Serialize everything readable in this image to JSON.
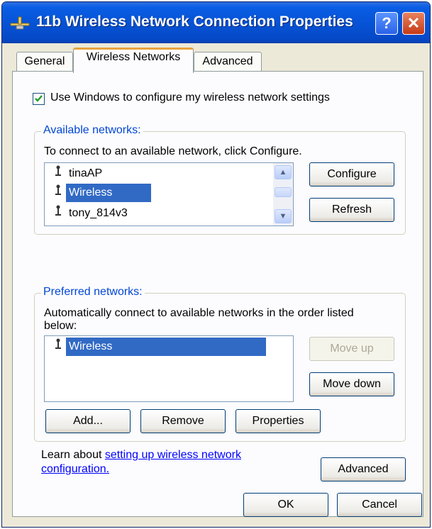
{
  "window": {
    "title": "11b Wireless Network Connection Properties",
    "help_label": "?",
    "close_label": "✕"
  },
  "tabs": [
    {
      "label": "General",
      "active": false
    },
    {
      "label": "Wireless Networks",
      "active": true
    },
    {
      "label": "Advanced",
      "active": false
    }
  ],
  "use_windows": {
    "label": "Use Windows to configure my wireless network settings",
    "checked": true
  },
  "available": {
    "group_label": "Available networks:",
    "instruction": "To connect to an available network, click Configure.",
    "networks": [
      {
        "name": "tinaAP",
        "selected": false
      },
      {
        "name": "Wireless",
        "selected": true
      },
      {
        "name": "tony_814v3",
        "selected": false
      }
    ],
    "configure_label": "Configure",
    "refresh_label": "Refresh"
  },
  "preferred": {
    "group_label": "Preferred networks:",
    "instruction_line1": "Automatically connect to available networks in the order listed",
    "instruction_line2": "below:",
    "networks": [
      {
        "name": "Wireless",
        "selected": true
      }
    ],
    "move_up_label": "Move up",
    "move_down_label": "Move down",
    "add_label": "Add...",
    "remove_label": "Remove",
    "properties_label": "Properties"
  },
  "learn": {
    "prefix": "Learn about ",
    "link_line1": "setting up wireless network",
    "link_line2": "configuration."
  },
  "advanced_label": "Advanced",
  "footer": {
    "ok_label": "OK",
    "cancel_label": "Cancel"
  },
  "colors": {
    "title_bar": "#0553d6",
    "selection": "#316ac5",
    "group_label": "#0046d5",
    "tab_highlight": "#e8a33d"
  }
}
